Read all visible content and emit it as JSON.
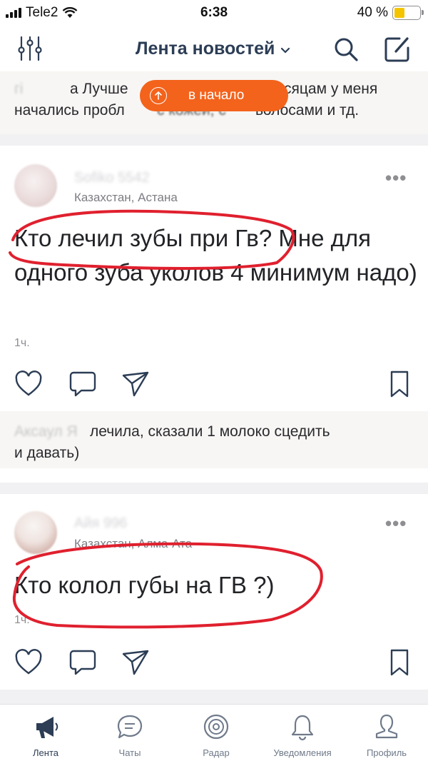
{
  "status_bar": {
    "carrier": "Tele2",
    "time": "6:38",
    "battery": "40 %",
    "battery_level": 0.4
  },
  "nav": {
    "title": "Лента новостей"
  },
  "scroll_top_button": {
    "label": "в начало"
  },
  "top_comment": {
    "line1_left": "а Лучше",
    "line1_right": "сяцам у меня",
    "line2": "начались пробл",
    "line2_mid": "с кожей, с",
    "line2_right": "волосами и тд."
  },
  "posts": [
    {
      "author": "Sofiko 5542",
      "location": "Казахстан, Астана",
      "text": "Кто лечил зубы при Гв? Мне для одного зуба уколов 4 минимум надо)",
      "time": "1ч.",
      "comment": {
        "author": "Аксаул Я",
        "line1": "лечила, сказали 1 молоко сцедить",
        "line2": "и давать)"
      }
    },
    {
      "author": "Айя 996",
      "location": "Казахстан, Алма-Ата",
      "text": "Кто колол губы на ГВ ?)",
      "time": "1ч."
    }
  ],
  "tabbar": {
    "tabs": [
      {
        "label": "Лента",
        "icon": "megaphone-icon"
      },
      {
        "label": "Чаты",
        "icon": "chat-bubble-icon"
      },
      {
        "label": "Радар",
        "icon": "radar-icon"
      },
      {
        "label": "Уведомления",
        "icon": "bell-icon"
      },
      {
        "label": "Профиль",
        "icon": "person-icon"
      }
    ]
  },
  "colors": {
    "accent": "#f3631c",
    "nav_title": "#2c3d55",
    "annotation": "#e0202e"
  }
}
